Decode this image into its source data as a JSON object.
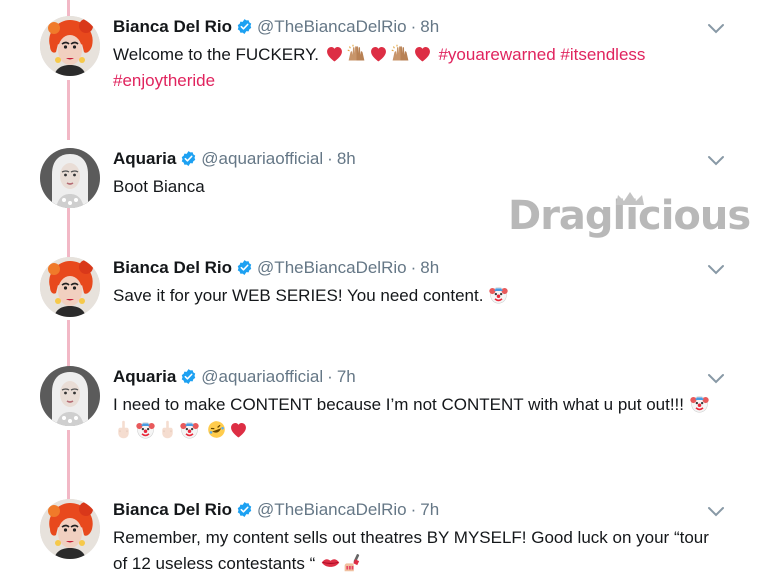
{
  "watermark": {
    "text": "Draglicious"
  },
  "tweets": [
    {
      "name": "Bianca Del Rio",
      "handle": "@TheBiancaDelRio",
      "dot": "·",
      "time": "8h",
      "avatar": "bianca-avatar",
      "line1_text": "Welcome to the FUCKERY.",
      "line1_emojis": [
        "red-heart",
        "raised-hands",
        "red-heart",
        "raised-hands",
        "red-heart"
      ],
      "hashtags_line1": "#youarewarned #itsendless",
      "hashtags_line2": "#enjoytheride"
    },
    {
      "name": "Aquaria",
      "handle": "@aquariaofficial",
      "dot": "·",
      "time": "8h",
      "avatar": "aquaria-avatar",
      "text": "Boot Bianca"
    },
    {
      "name": "Bianca Del Rio",
      "handle": "@TheBiancaDelRio",
      "dot": "·",
      "time": "8h",
      "avatar": "bianca-avatar",
      "text": "Save it for your WEB SERIES! You need content.",
      "emojis": [
        "clown-face"
      ]
    },
    {
      "name": "Aquaria",
      "handle": "@aquariaofficial",
      "dot": "·",
      "time": "7h",
      "avatar": "aquaria-avatar",
      "text": "I need to make CONTENT because I’m not CONTENT with what u put out!!!",
      "emojis": [
        "clown-face"
      ],
      "line2_emojis": [
        "middle-finger",
        "clown-face",
        "middle-finger",
        "clown-face",
        "rolling-laughing",
        "red-heart"
      ]
    },
    {
      "name": "Bianca Del Rio",
      "handle": "@TheBiancaDelRio",
      "dot": "·",
      "time": "7h",
      "avatar": "bianca-avatar",
      "line1_text": "Remember, my content sells out theatres BY MYSELF! Good luck on your “tour",
      "line2_text": "of 12 useless contestants “",
      "line2_emojis": [
        "kiss-mark",
        "nail-polish"
      ]
    }
  ],
  "colors": {
    "accent": "#e0245e",
    "verified": "#1da1f2",
    "muted": "#657786",
    "thread": "#f2b8c6"
  }
}
